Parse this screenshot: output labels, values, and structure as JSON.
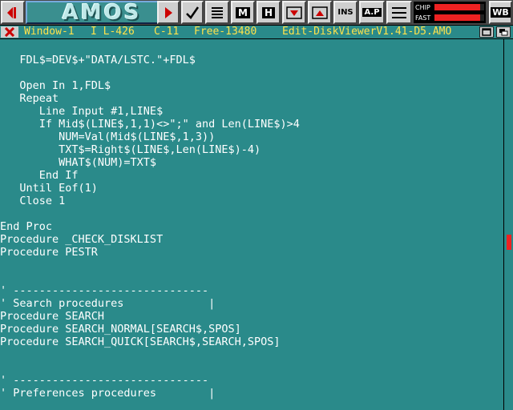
{
  "toolbar": {
    "logo_text": "AMOS",
    "buttons": [
      {
        "name": "prev-button",
        "icon": "play-left-icon",
        "label": ""
      },
      {
        "name": "run-button",
        "icon": "play-right-icon",
        "label": ""
      },
      {
        "name": "test-button",
        "icon": "checkmark-icon",
        "label": ""
      },
      {
        "name": "indent-button",
        "icon": "lines-icon",
        "label": ""
      },
      {
        "name": "marks-button",
        "icon": "",
        "label": "M"
      },
      {
        "name": "help-button",
        "icon": "",
        "label": "H"
      },
      {
        "name": "fold-button",
        "icon": "fold-down-icon",
        "label": ""
      },
      {
        "name": "unfold-button",
        "icon": "fold-up-icon",
        "label": ""
      },
      {
        "name": "insert-button",
        "icon": "",
        "label": "INS"
      },
      {
        "name": "paste-button",
        "icon": "",
        "label": "A.P"
      },
      {
        "name": "lines-button",
        "icon": "lines-icon",
        "label": ""
      }
    ],
    "memory": {
      "chip_label": "CHIP",
      "fast_label": "FAST",
      "chip_level": 0.92,
      "fast_level": 0.92
    },
    "wb_label": "WB",
    "colors": {
      "accent_red": "#e22222",
      "status_yellow": "#ffe24a",
      "editor_bg": "#2a8a8a"
    }
  },
  "status": {
    "window": "Window-1",
    "line": "I L-426",
    "column": "C-11",
    "free": "Free-13480",
    "title": "Edit-DiskViewerV1.41-D5.AMO"
  },
  "code": [
    "",
    "   FDL$=DEV$+\"DATA/LSTC.\"+FDL$",
    "",
    "   Open In 1,FDL$",
    "   Repeat",
    "      Line Input #1,LINE$",
    "      If Mid$(LINE$,1,1)<>\";\" and Len(LINE$)>4",
    "         NUM=Val(Mid$(LINE$,1,3))",
    "         TXT$=Right$(LINE$,Len(LINE$)-4)",
    "         WHAT$(NUM)=TXT$",
    "      End If",
    "   Until Eof(1)",
    "   Close 1",
    "",
    "End Proc",
    "Procedure _CHECK_DISKLIST",
    "Procedure PESTR",
    "",
    "",
    "' ------------------------------",
    "' Search procedures             |",
    "Procedure SEARCH",
    "Procedure SEARCH_NORMAL[SEARCH$,SPOS]",
    "Procedure SEARCH_QUICK[SEARCH$,SEARCH,SPOS]",
    "",
    "",
    "' ------------------------------",
    "' Preferences procedures        |"
  ],
  "scroll": {
    "position": 0.55,
    "thumb_fraction": 0.04
  }
}
